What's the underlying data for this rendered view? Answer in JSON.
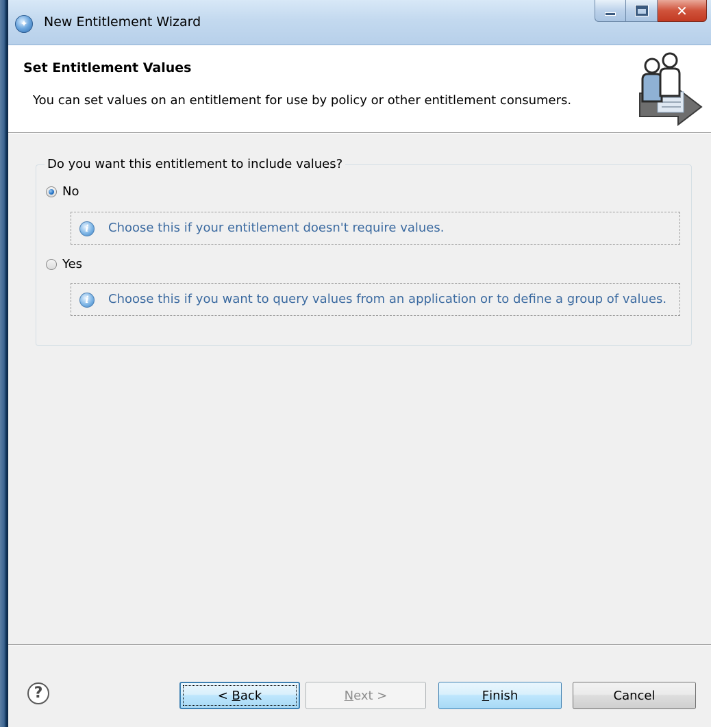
{
  "window": {
    "title": "New Entitlement Wizard"
  },
  "header": {
    "title": "Set Entitlement Values",
    "description": "You can set values on an entitlement for use by policy or other entitlement consumers."
  },
  "group": {
    "legend": "Do you want this entitlement to include values?",
    "options": [
      {
        "label": "No",
        "checked": true,
        "hint": "Choose this if your entitlement doesn't require values."
      },
      {
        "label": "Yes",
        "checked": false,
        "hint": "Choose this if you want to query values from an application or to define a group of values."
      }
    ]
  },
  "footer": {
    "back": {
      "prefix": "< ",
      "mnemonic": "B",
      "rest": "ack"
    },
    "next": {
      "mnemonic": "N",
      "rest": "ext >"
    },
    "finish": {
      "mnemonic": "F",
      "rest": "inish"
    },
    "cancel": "Cancel"
  },
  "icons": {
    "app": "wizard-app-icon",
    "banner": "users-arrow-icon",
    "info": "info-icon",
    "help": "help-icon"
  }
}
